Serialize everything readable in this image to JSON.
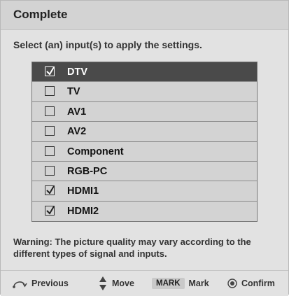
{
  "dialog": {
    "title": "Complete",
    "instruction": "Select (an) input(s) to apply the settings.",
    "warning": "Warning: The picture quality may vary according to the different types of signal and inputs."
  },
  "inputs": [
    {
      "label": "DTV",
      "checked": true,
      "selected": true
    },
    {
      "label": "TV",
      "checked": false,
      "selected": false
    },
    {
      "label": "AV1",
      "checked": false,
      "selected": false
    },
    {
      "label": "AV2",
      "checked": false,
      "selected": false
    },
    {
      "label": "Component",
      "checked": false,
      "selected": false
    },
    {
      "label": "RGB-PC",
      "checked": false,
      "selected": false
    },
    {
      "label": "HDMI1",
      "checked": true,
      "selected": false
    },
    {
      "label": "HDMI2",
      "checked": true,
      "selected": false
    }
  ],
  "footer": {
    "previous": {
      "label": "Previous",
      "icon": "return-arrow-icon"
    },
    "move": {
      "label": "Move",
      "icon": "up-down-arrows-icon"
    },
    "mark": {
      "badge": "MARK",
      "label": "Mark"
    },
    "confirm": {
      "label": "Confirm",
      "icon": "ok-circle-icon"
    }
  },
  "colors": {
    "background": "#e2e2e2",
    "selected_row": "#4a4a4a",
    "row": "#d3d3d3"
  }
}
